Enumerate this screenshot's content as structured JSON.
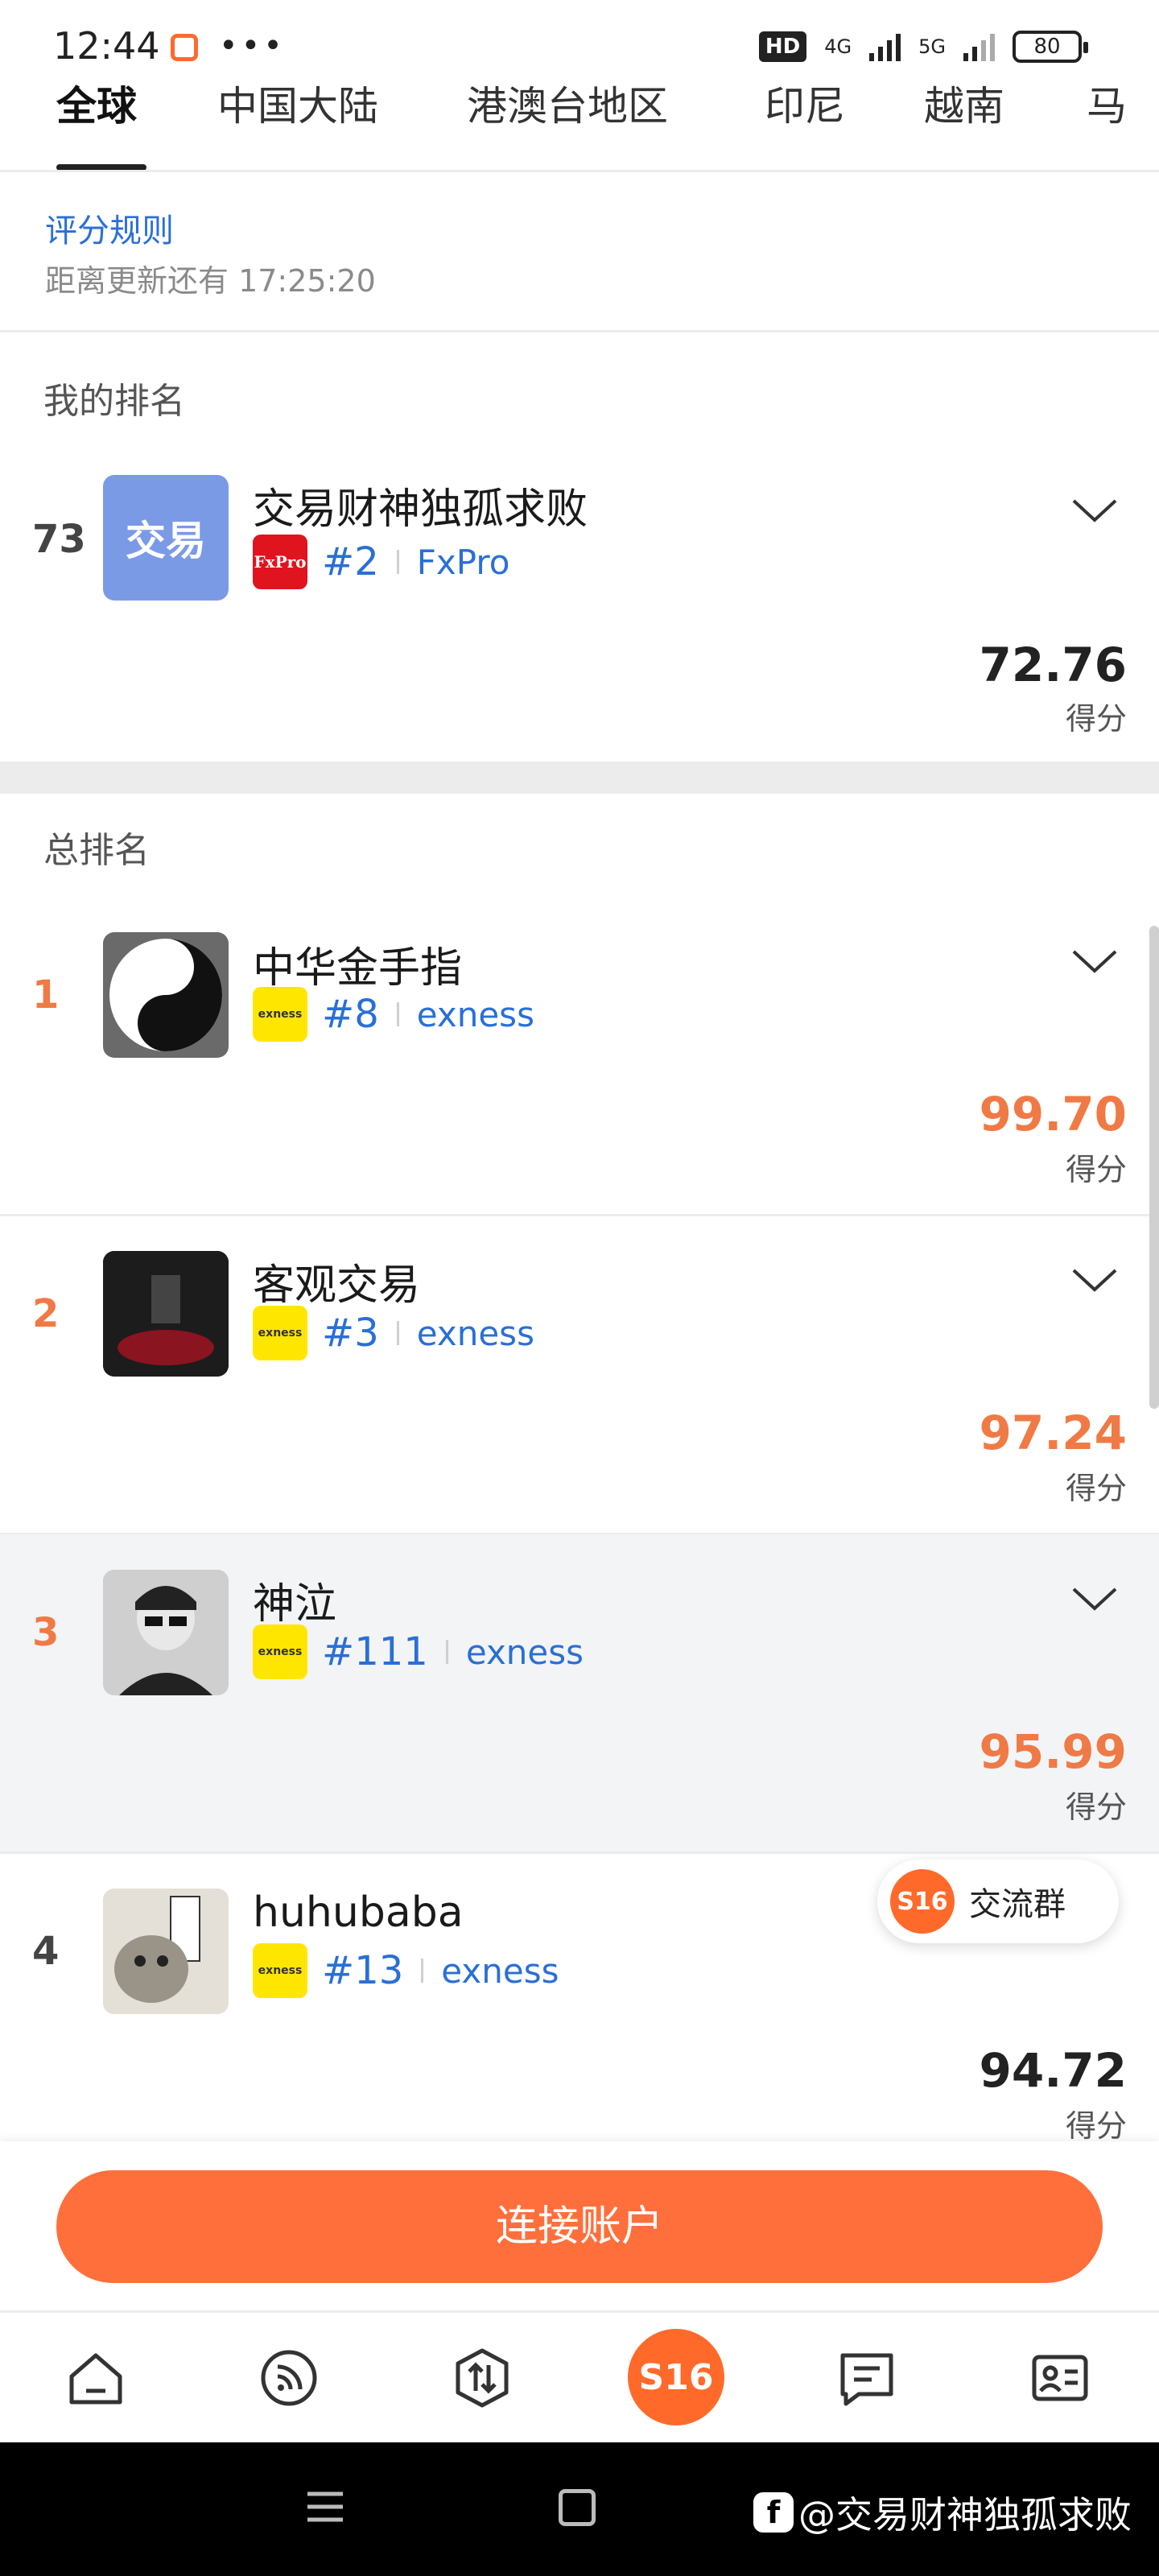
{
  "status_bar": {
    "time": "12:44",
    "dots": "•••",
    "hd": "HD",
    "net1": "4G",
    "net2": "5G",
    "battery": "80"
  },
  "tabs": [
    "全球",
    "中国大陆",
    "港澳台地区",
    "印尼",
    "越南",
    "马"
  ],
  "rules_link": "评分规则",
  "countdown": "距离更新还有 17:25:20",
  "my_rank": {
    "section_label": "我的排名",
    "rank": "73",
    "avatar_text": "交易",
    "name": "交易财神独孤求败",
    "broker_logo": "FxPro",
    "broker_rank": "#2",
    "broker_name": "FxPro",
    "score": "72.76",
    "score_label": "得分"
  },
  "overall": {
    "section_label": "总排名",
    "rows": [
      {
        "rank": "1",
        "name": "中华金手指",
        "broker_logo": "exness",
        "broker_rank": "#8",
        "broker_name": "exness",
        "score": "99.70",
        "score_label": "得分"
      },
      {
        "rank": "2",
        "name": "客观交易",
        "broker_logo": "exness",
        "broker_rank": "#3",
        "broker_name": "exness",
        "score": "97.24",
        "score_label": "得分"
      },
      {
        "rank": "3",
        "name": "神泣",
        "broker_logo": "exness",
        "broker_rank": "#111",
        "broker_name": "exness",
        "score": "95.99",
        "score_label": "得分"
      },
      {
        "rank": "4",
        "name": "huhubaba",
        "broker_logo": "exness",
        "broker_rank": "#13",
        "broker_name": "exness",
        "score": "94.72",
        "score_label": "得分"
      }
    ]
  },
  "group_chip": {
    "logo": "S16",
    "label": "交流群"
  },
  "connect_button": "连接账户",
  "nav": {
    "center": "S16"
  },
  "watermark": "@交易财神独孤求败",
  "colors": {
    "accent": "#ff6f3c",
    "link": "#2a6fd6",
    "top_rank": "#f07a45",
    "exness": "#ffe600",
    "fxpro": "#e0141e"
  }
}
